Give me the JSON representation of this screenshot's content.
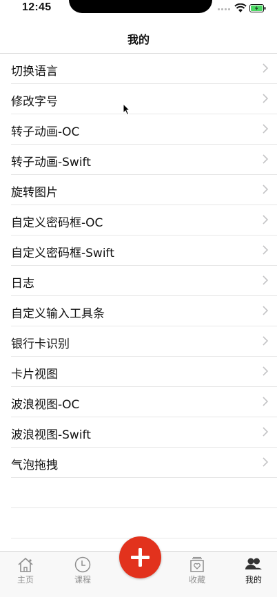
{
  "status_bar": {
    "time": "12:45"
  },
  "nav": {
    "title": "我的"
  },
  "menu": [
    {
      "label": "切换语言"
    },
    {
      "label": "修改字号"
    },
    {
      "label": "转子动画-OC"
    },
    {
      "label": "转子动画-Swift"
    },
    {
      "label": "旋转图片"
    },
    {
      "label": "自定义密码框-OC"
    },
    {
      "label": "自定义密码框-Swift"
    },
    {
      "label": "日志"
    },
    {
      "label": "自定义输入工具条"
    },
    {
      "label": "银行卡识别"
    },
    {
      "label": "卡片视图"
    },
    {
      "label": "波浪视图-OC"
    },
    {
      "label": "波浪视图-Swift"
    },
    {
      "label": "气泡拖拽"
    }
  ],
  "tabs": {
    "home": {
      "label": "主页",
      "icon": "home-icon"
    },
    "course": {
      "label": "课程",
      "icon": "clock-icon"
    },
    "favorites": {
      "label": "收藏",
      "icon": "heart-box-icon"
    },
    "mine": {
      "label": "我的",
      "icon": "people-icon"
    }
  },
  "colors": {
    "accent": "#e2321d",
    "tab_active": "#111111",
    "tab_inactive": "#8e8e8e"
  }
}
